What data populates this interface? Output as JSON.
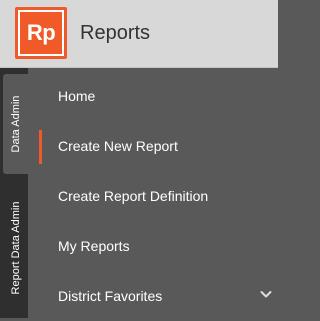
{
  "header": {
    "logo_text": "Rp",
    "title": "Reports"
  },
  "side_tabs": [
    {
      "label": "Data Admin",
      "active": true
    },
    {
      "label": "Report Data Admin",
      "active": false
    }
  ],
  "menu": {
    "items": [
      {
        "label": "Home",
        "active": false
      },
      {
        "label": "Create New Report",
        "active": true
      },
      {
        "label": "Create Report Definition",
        "active": false
      },
      {
        "label": "My Reports",
        "active": false
      },
      {
        "label": "District Favorites",
        "active": false,
        "expandable": true,
        "icon": "chevron-down-icon"
      }
    ]
  },
  "colors": {
    "accent": "#f05a28",
    "header_bg": "#d8d8d8",
    "menu_bg": "#595959",
    "tab_rail_bg": "#2f2f2f"
  }
}
